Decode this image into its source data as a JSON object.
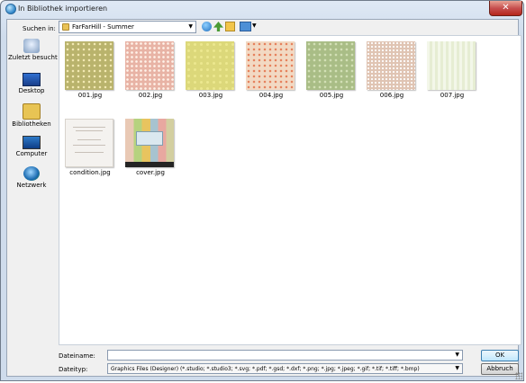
{
  "window": {
    "title": "In Bibliothek importieren",
    "close_label": "✕"
  },
  "toolbar": {
    "look_in_label": "Suchen in:",
    "look_in_value": "FarFarHill - Summer",
    "icons": [
      "back-icon",
      "up-folder-icon",
      "new-folder-icon",
      "views-menu-icon"
    ]
  },
  "places": [
    {
      "label": "Zuletzt besucht",
      "icon": "recent-places-icon"
    },
    {
      "label": "Desktop",
      "icon": "desktop-icon"
    },
    {
      "label": "Bibliotheken",
      "icon": "libraries-icon"
    },
    {
      "label": "Computer",
      "icon": "computer-icon"
    },
    {
      "label": "Netzwerk",
      "icon": "network-icon"
    }
  ],
  "files": [
    {
      "name": "001.jpg"
    },
    {
      "name": "002.jpg"
    },
    {
      "name": "003.jpg"
    },
    {
      "name": "004.jpg"
    },
    {
      "name": "005.jpg"
    },
    {
      "name": "006.jpg"
    },
    {
      "name": "007.jpg"
    },
    {
      "name": "condition.jpg"
    },
    {
      "name": "cover.jpg"
    }
  ],
  "bottom": {
    "filename_label": "Dateiname:",
    "filename_value": "",
    "filetype_label": "Dateityp:",
    "filetype_value": "Graphics Files (Designer) (*.studio; *.studio3; *.svg; *.pdf; *.gsd; *.dxf; *.png; *.jpg; *.jpeg; *.gif; *.tif; *.tiff; *.bmp)",
    "ok_label": "OK",
    "cancel_label": "Abbruch"
  }
}
